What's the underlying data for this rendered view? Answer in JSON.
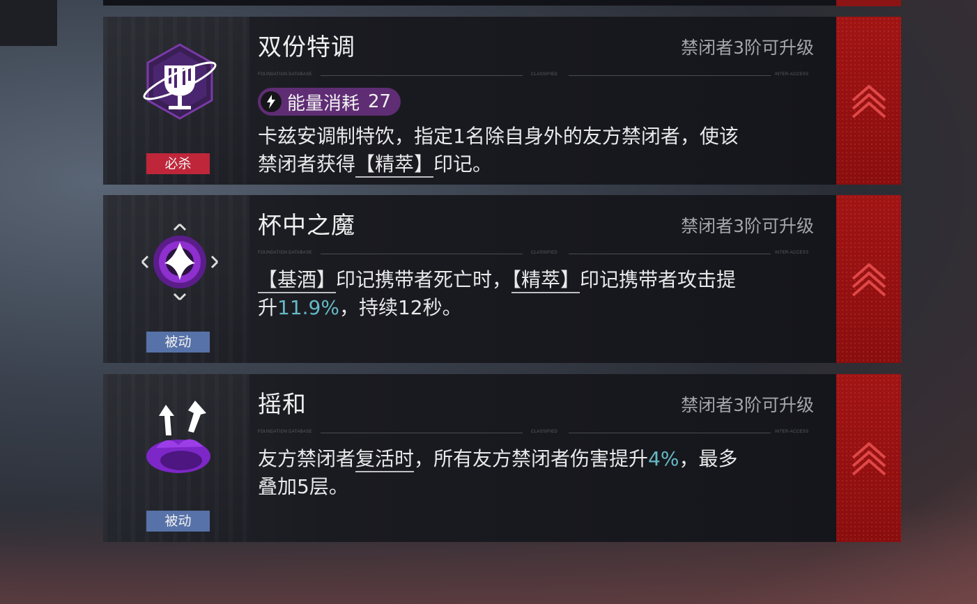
{
  "skills": [
    {
      "name": "双份特调",
      "upgrade_note": "禁闭者3阶可升级",
      "tag": "必杀",
      "tag_color": "#c0263a",
      "icon": "chalice-icon",
      "energy": {
        "label": "能量消耗",
        "value": "27"
      },
      "description": {
        "line1": "卡兹安调制特饮，指定1名除自身外的友方禁闭者，使该",
        "line2_pre": "禁闭者获得",
        "line2_key": "【精萃】",
        "line2_post": "印记。"
      }
    },
    {
      "name": "杯中之魔",
      "upgrade_note": "禁闭者3阶可升级",
      "tag": "被动",
      "tag_color": "#5772a8",
      "icon": "demon-sigil-icon",
      "description": {
        "k1": "【基酒】",
        "t1": "印记携带者死亡时，",
        "k2": "【精萃】",
        "t2": "印记携带者攻击提",
        "t3": "升",
        "v1": "11.9%",
        "t4": "，持续12秒。"
      }
    },
    {
      "name": "摇和",
      "upgrade_note": "禁闭者3阶可升级",
      "tag": "被动",
      "tag_color": "#5772a8",
      "icon": "shaker-burst-icon",
      "description": {
        "t1": "友方禁闭者",
        "k1": "复活时",
        "t2": "，所有友方禁闭者伤害提升",
        "v1": "4%",
        "t3": "，最多",
        "line2": "叠加5层。"
      }
    }
  ],
  "divider_labels": {
    "left": "FOUNDATION DATABASE",
    "mid": "CLASSIFIED",
    "right": "INTER-ACCESS"
  },
  "colors": {
    "accent_red": "#8d1414",
    "highlight_cyan": "#65b9c6",
    "energy_purple": "#5f2d74"
  }
}
